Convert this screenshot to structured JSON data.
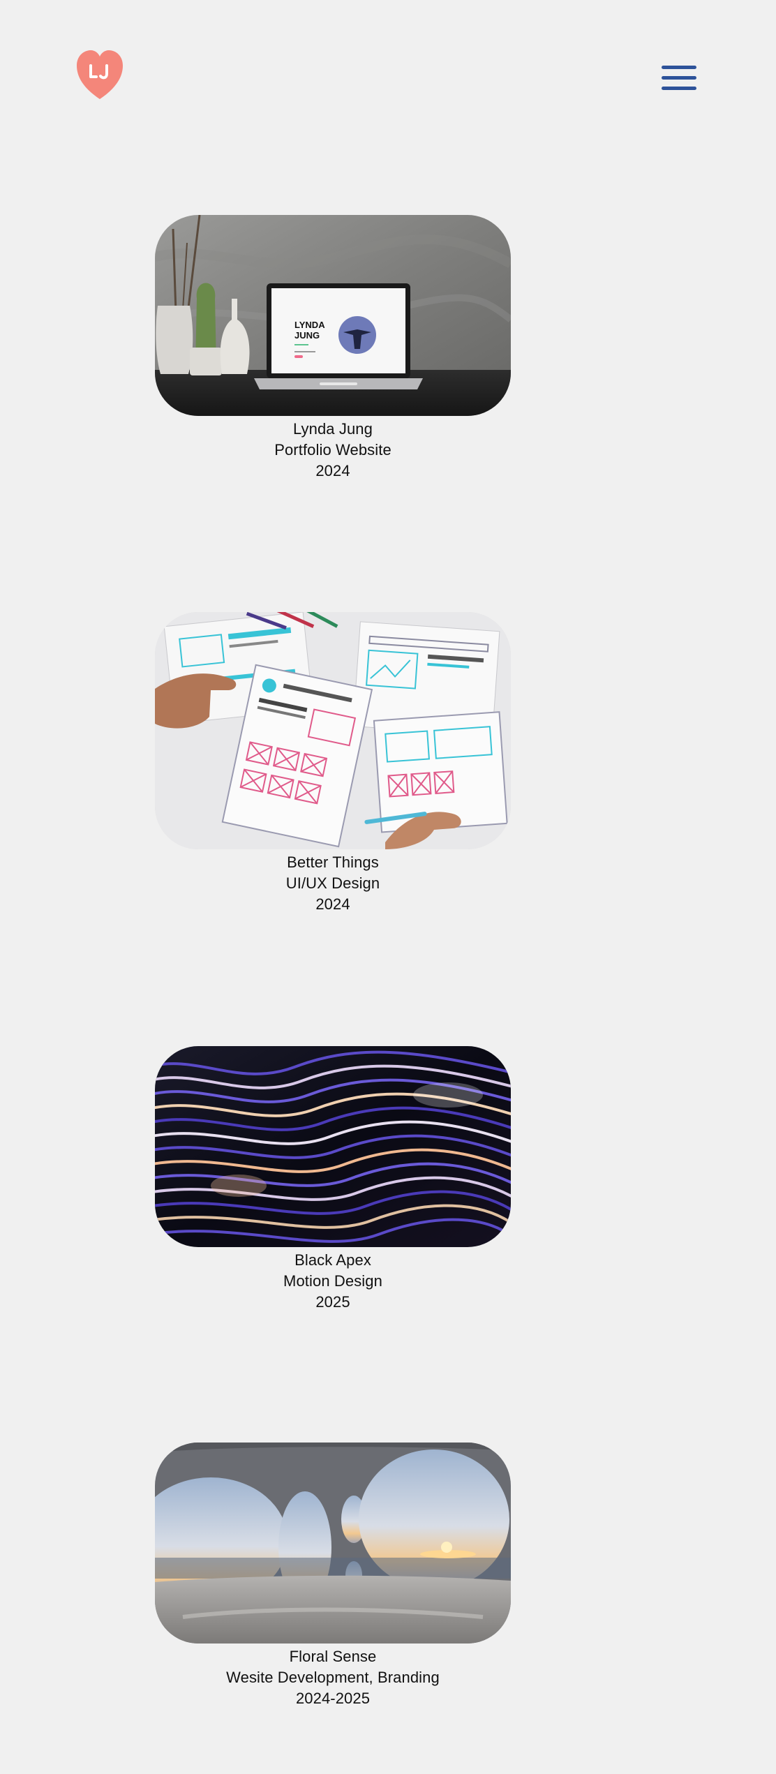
{
  "site": {
    "logo": {
      "icon": "heart-logo-icon",
      "color": "#f4867a",
      "monogram": "LJ"
    },
    "menu": {
      "icon": "hamburger-menu-icon",
      "color": "#2d5299"
    }
  },
  "projects": [
    {
      "title": "Lynda Jung",
      "category": "Portfolio Website",
      "year": "2024",
      "image": "laptop-portfolio-mockup",
      "screen": {
        "name_line1": "LYNDA",
        "name_line2": "JUNG"
      }
    },
    {
      "title": "Better Things",
      "category": "UI/UX Design",
      "year": "2024",
      "image": "wireframe-sketches"
    },
    {
      "title": "Black Apex",
      "category": "Motion Design",
      "year": "2025",
      "image": "abstract-wave-render"
    },
    {
      "title": "Floral Sense",
      "category": "Wesite Development, Branding",
      "year": "2024-2025",
      "image": "architecture-sea-view"
    }
  ]
}
